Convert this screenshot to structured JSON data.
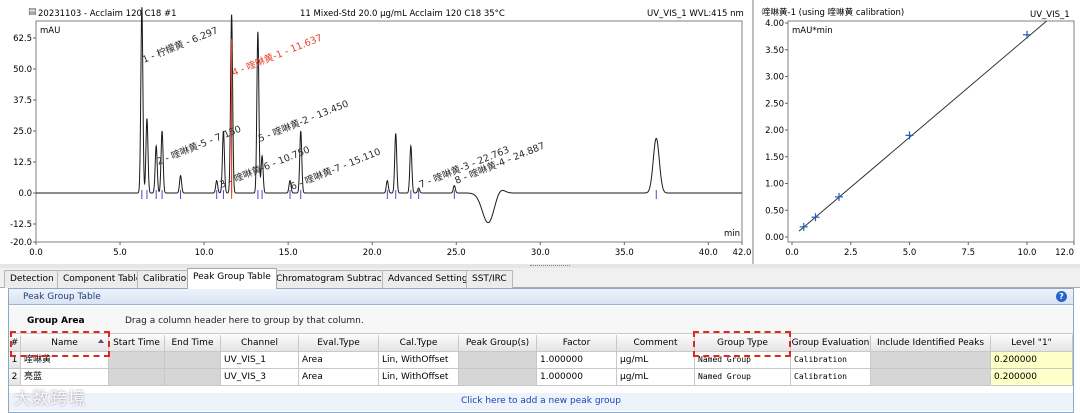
{
  "chromatogram": {
    "header_left": "20231103 - Acclaim 120 C18 #1",
    "header_center": "11 Mixed-Std 20.0 µg/mL Acclaim 120 C18 35°C",
    "header_right": "UV_VIS_1 WVL:415 nm",
    "y_unit": "mAU",
    "x_unit": "min",
    "y_ticks": [
      "62.5",
      "50.0",
      "37.5",
      "25.0",
      "12.5",
      "0.0",
      "-12.5",
      "-20.0"
    ],
    "x_ticks": [
      "0.0",
      "5.0",
      "10.0",
      "15.0",
      "20.0",
      "25.0",
      "30.0",
      "35.0",
      "40.0",
      "42.0"
    ],
    "peak_labels": [
      {
        "text": "1 - 柠檬黄 - 6.297",
        "highlight": false
      },
      {
        "text": "4 - 喹啉黄-1 - 11.637",
        "highlight": true
      },
      {
        "text": "5 - 喹啉黄-2 - 13.450",
        "highlight": false
      },
      {
        "text": "2 - 喹啉黄-5 - 7.150",
        "highlight": false
      },
      {
        "text": "3 - 喹啉黄-6 - 10.750",
        "highlight": false
      },
      {
        "text": "6 - 喹啉黄-7 - 15.110",
        "highlight": false
      },
      {
        "text": "7 - 喹啉黄-3 - 22.763",
        "highlight": false
      },
      {
        "text": "8 - 喹啉黄-4 - 24.887",
        "highlight": false
      }
    ]
  },
  "chart_data": [
    {
      "type": "line",
      "title": "",
      "xlabel": "min",
      "ylabel": "mAU",
      "xlim": [
        0,
        42
      ],
      "ylim": [
        -20,
        70
      ],
      "grid": false,
      "baseline": 0,
      "peaks": [
        {
          "rt": 6.297,
          "height": 75
        },
        {
          "rt": 6.6,
          "height": 30
        },
        {
          "rt": 7.15,
          "height": 19
        },
        {
          "rt": 7.5,
          "height": 25
        },
        {
          "rt": 8.6,
          "height": 7
        },
        {
          "rt": 10.75,
          "height": 5
        },
        {
          "rt": 11.15,
          "height": 25
        },
        {
          "rt": 11.637,
          "height": 72
        },
        {
          "rt": 13.2,
          "height": 65
        },
        {
          "rt": 13.45,
          "height": 15
        },
        {
          "rt": 15.11,
          "height": 5
        },
        {
          "rt": 15.75,
          "height": 25
        },
        {
          "rt": 20.9,
          "height": 5
        },
        {
          "rt": 21.4,
          "height": 24
        },
        {
          "rt": 22.3,
          "height": 19
        },
        {
          "rt": 22.763,
          "height": 2
        },
        {
          "rt": 24.887,
          "height": 3
        },
        {
          "rt": 36.9,
          "height": 22
        }
      ],
      "dips": [
        {
          "rt": 26.9,
          "depth": -12
        }
      ]
    },
    {
      "type": "scatter",
      "title": "喹啉黄-1 (using 喹啉黄 calibration)",
      "xlabel": "",
      "ylabel": "mAU*min",
      "channel": "UV_VIS_1",
      "xlim": [
        0,
        12
      ],
      "ylim": [
        0,
        4
      ],
      "x": [
        0.5,
        1.0,
        2.0,
        5.0,
        10.0
      ],
      "y": [
        0.19,
        0.37,
        0.75,
        1.9,
        3.78
      ],
      "fit": "linear"
    }
  ],
  "calibration": {
    "title": "喹啉黄-1 (using 喹啉黄 calibration)",
    "channel": "UV_VIS_1",
    "y_unit": "mAU*min",
    "y_ticks": [
      "4.00",
      "3.50",
      "3.00",
      "2.50",
      "2.00",
      "1.50",
      "1.00",
      "0.50",
      "0.00"
    ],
    "x_ticks": [
      "0.0",
      "2.5",
      "5.0",
      "7.5",
      "10.0",
      "12.0"
    ]
  },
  "tabs": [
    {
      "label": "Detection",
      "active": false
    },
    {
      "label": "Component Table",
      "active": false
    },
    {
      "label": "Calibration",
      "active": false
    },
    {
      "label": "Peak Group Table",
      "active": true
    },
    {
      "label": "Chromatogram Subtraction",
      "active": false
    },
    {
      "label": "Advanced Settings",
      "active": false
    },
    {
      "label": "SST/IRC",
      "active": false
    }
  ],
  "panel": {
    "title": "Peak Group Table",
    "group_area_label": "Group Area",
    "group_area_hint": "Drag a column header here to group by that column.",
    "add_row_text": "Click here to add a new peak group"
  },
  "table": {
    "columns": [
      "#",
      "Name",
      "Start Time",
      "End Time",
      "Channel",
      "Eval.Type",
      "Cal.Type",
      "Peak Group(s)",
      "Factor",
      "Comment",
      "Group Type",
      "Group Evaluation",
      "Include Identified Peaks",
      "Level \"1\""
    ],
    "rows": [
      [
        "1",
        "喹啉黄",
        "",
        "",
        "UV_VIS_1",
        "Area",
        "Lin, WithOffset",
        "",
        "1.000000",
        "µg/mL",
        "Named Group",
        "Calibration",
        "",
        "0.200000"
      ],
      [
        "2",
        "亮蓝",
        "",
        "",
        "UV_VIS_3",
        "Area",
        "Lin, WithOffset",
        "",
        "1.000000",
        "µg/mL",
        "Named Group",
        "Calibration",
        "",
        "0.200000"
      ]
    ]
  },
  "colors": {
    "trace": "#1a1a1a",
    "highlight": "#e8402a",
    "calibration_line": "#333333",
    "calibration_marker": "#1f5fbf",
    "dashed_annotation": "#e0281b"
  },
  "watermark": "大数跨境"
}
